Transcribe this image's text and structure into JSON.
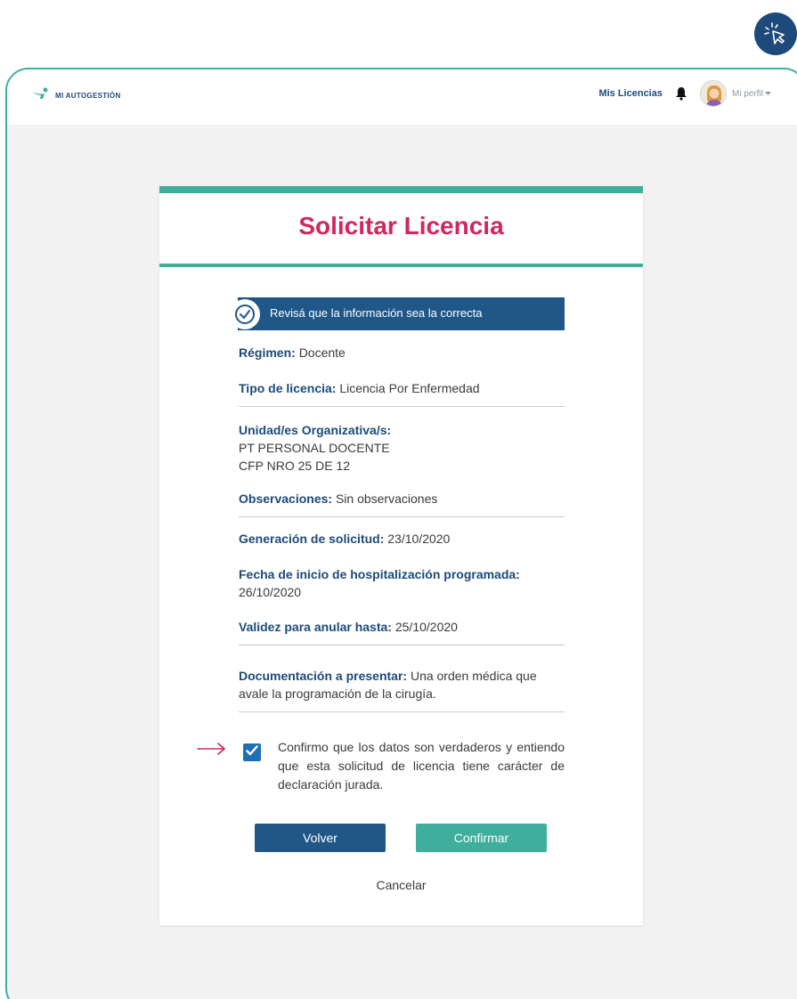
{
  "brand": {
    "name": "MI AUTOGESTIÓN"
  },
  "nav": {
    "licencias_label": "Mis Licencias",
    "profile_label": "Mi perfil"
  },
  "card": {
    "title": "Solicitar Licencia",
    "banner_text": "Revisá que la información sea la correcta"
  },
  "fields": {
    "regimen": {
      "label": "Régimen:",
      "value": "Docente"
    },
    "tipo": {
      "label": "Tipo de licencia:",
      "value": "Licencia Por Enfermedad"
    },
    "unidad": {
      "label": "Unidad/es Organizativa/s:",
      "line1": "PT PERSONAL DOCENTE",
      "line2": "CFP NRO 25 DE 12"
    },
    "observaciones": {
      "label": "Observaciones:",
      "value": "Sin observaciones"
    },
    "generacion": {
      "label": "Generación de solicitud:",
      "value": "23/10/2020"
    },
    "fecha_inicio": {
      "label": "Fecha de inicio de hospitalización programada:",
      "value": "26/10/2020"
    },
    "validez": {
      "label": "Validez para anular hasta:",
      "value": "25/10/2020"
    },
    "documentacion": {
      "label": "Documentación a presentar:",
      "value": "Una orden médica que avale la programación de la cirugía."
    }
  },
  "confirm": {
    "checked": true,
    "text": "Confirmo que los datos son verdaderos y entiendo que esta solicitud de licencia tiene carácter de declaración jurada."
  },
  "actions": {
    "back_label": "Volver",
    "confirm_label": "Confirmar",
    "cancel_label": "Cancelar"
  },
  "colors": {
    "teal": "#3fae9c",
    "navy": "#1d4a7a",
    "banner": "#1f5788",
    "title": "#d1275d",
    "checkbox": "#1f6fb5"
  },
  "icons": {
    "badge": "cursor-click-icon",
    "brand": "brand-logo-icon",
    "bell": "bell-icon",
    "banner": "check-circle-icon",
    "checkbox": "checkmark-icon",
    "arrow": "arrow-right-icon",
    "profile": "caret-down-icon"
  }
}
